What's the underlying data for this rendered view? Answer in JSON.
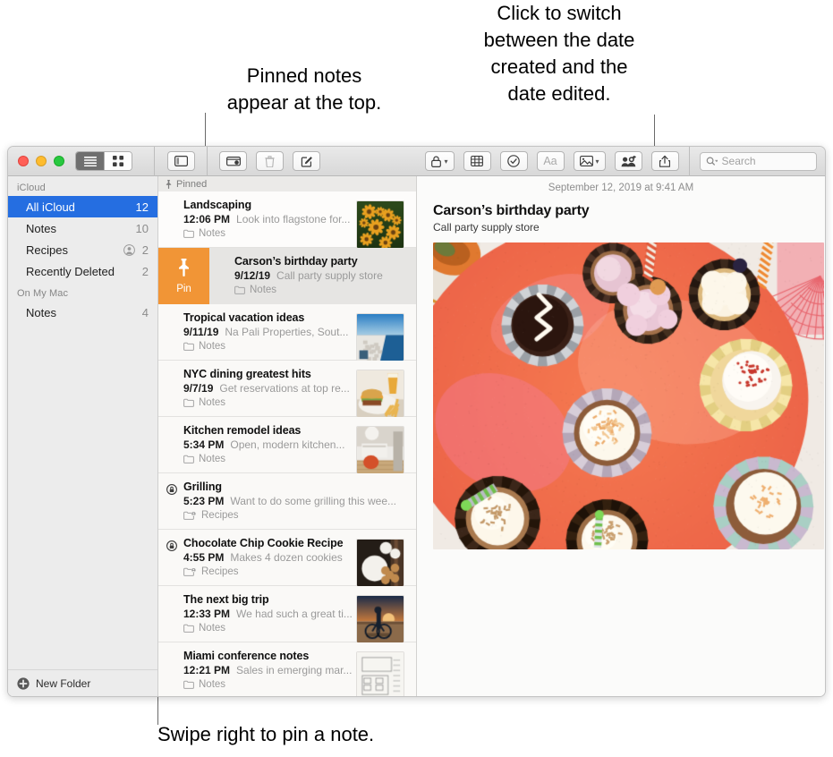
{
  "callouts": {
    "pinned": "Pinned notes\nappear at the top.",
    "date": "Click to switch\nbetween the date\ncreated and the\ndate edited.",
    "swipe": "Swipe right to pin a note."
  },
  "toolbar": {
    "view_list": "list-view",
    "view_grid": "grid-view",
    "sidebar_toggle": "sidebar-toggle",
    "compose_folder": "add-folder",
    "delete": "delete",
    "new_note": "new-note",
    "lock": "lock",
    "table": "table",
    "checklist": "checklist",
    "format": "Aa",
    "media": "media",
    "share_people": "add-people",
    "share": "share",
    "search_placeholder": "Search",
    "search_value": ""
  },
  "sidebar": {
    "sections": [
      {
        "header": "iCloud",
        "items": [
          {
            "label": "All iCloud",
            "count": "12",
            "selected": true,
            "shared": false
          },
          {
            "label": "Notes",
            "count": "10",
            "selected": false,
            "shared": false
          },
          {
            "label": "Recipes",
            "count": "2",
            "selected": false,
            "shared": true
          },
          {
            "label": "Recently Deleted",
            "count": "2",
            "selected": false,
            "shared": false
          }
        ]
      },
      {
        "header": "On My Mac",
        "items": [
          {
            "label": "Notes",
            "count": "4",
            "selected": false,
            "shared": false
          }
        ]
      }
    ],
    "new_folder_label": "New Folder"
  },
  "notelist": {
    "pinned_header": "Pinned",
    "pin_action_label": "Pin",
    "rows": [
      {
        "title": "Landscaping",
        "date": "12:06 PM",
        "snippet": "Look into flagstone for...",
        "folder": "Notes",
        "folder_shared": false,
        "locked": false,
        "swiped": false,
        "white": true,
        "thumb": "flowers"
      },
      {
        "title": "Carson’s birthday party",
        "date": "9/12/19",
        "snippet": "Call party supply store",
        "folder": "Notes",
        "folder_shared": false,
        "locked": false,
        "swiped": true,
        "white": false,
        "thumb": "none"
      },
      {
        "title": "Tropical vacation ideas",
        "date": "9/11/19",
        "snippet": "Na Pali Properties, Sout...",
        "folder": "Notes",
        "folder_shared": false,
        "locked": false,
        "swiped": false,
        "white": false,
        "thumb": "coast"
      },
      {
        "title": "NYC dining greatest hits",
        "date": "9/7/19",
        "snippet": "Get reservations at top re...",
        "folder": "Notes",
        "folder_shared": false,
        "locked": false,
        "swiped": false,
        "white": false,
        "thumb": "burger"
      },
      {
        "title": "Kitchen remodel ideas",
        "date": "5:34 PM",
        "snippet": "Open, modern kitchen...",
        "folder": "Notes",
        "folder_shared": false,
        "locked": false,
        "swiped": false,
        "white": false,
        "thumb": "kitchen"
      },
      {
        "title": "Grilling",
        "date": "5:23 PM",
        "snippet": "Want to do some grilling this wee...",
        "folder": "Recipes",
        "folder_shared": true,
        "locked": true,
        "swiped": false,
        "white": false,
        "thumb": "none"
      },
      {
        "title": "Chocolate Chip Cookie Recipe",
        "date": "4:55 PM",
        "snippet": "Makes 4 dozen cookies",
        "folder": "Recipes",
        "folder_shared": true,
        "locked": true,
        "swiped": false,
        "white": false,
        "thumb": "cookies"
      },
      {
        "title": "The next big trip",
        "date": "12:33 PM",
        "snippet": "We had such a great ti...",
        "folder": "Notes",
        "folder_shared": false,
        "locked": false,
        "swiped": false,
        "white": false,
        "thumb": "cyclist"
      },
      {
        "title": "Miami conference notes",
        "date": "12:21 PM",
        "snippet": "Sales in emerging mar...",
        "folder": "Notes",
        "folder_shared": false,
        "locked": false,
        "swiped": false,
        "white": false,
        "thumb": "sketch"
      }
    ]
  },
  "detail": {
    "date": "September 12, 2019 at 9:41 AM",
    "title": "Carson’s birthday party",
    "body": "Call party supply store",
    "photo": "cupcakes"
  },
  "colors": {
    "accent_blue": "#256ee1",
    "pin_orange": "#f19536",
    "window_chrome": "#ececec",
    "list_bg": "#faf9f7"
  }
}
